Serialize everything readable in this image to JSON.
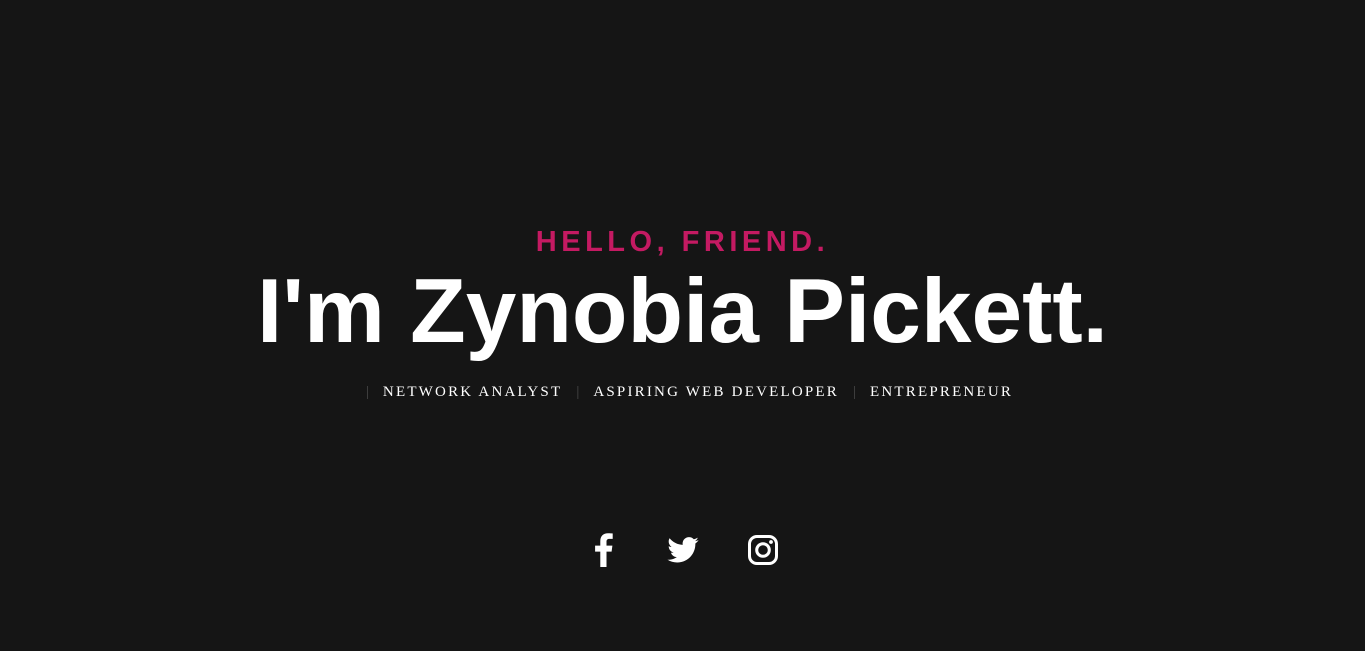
{
  "hero": {
    "greeting": "HELLO, FRIEND.",
    "name": "I'm Zynobia Pickett.",
    "roles": [
      "NETWORK ANALYST",
      "ASPIRING WEB DEVELOPER",
      "ENTREPRENEUR"
    ],
    "separator": "|"
  },
  "social": {
    "links": [
      {
        "icon": "facebook-icon"
      },
      {
        "icon": "twitter-icon"
      },
      {
        "icon": "instagram-icon"
      }
    ]
  },
  "colors": {
    "background": "#151515",
    "accent": "#c41a62",
    "text": "#ffffff",
    "separator": "#4a4a4a"
  }
}
